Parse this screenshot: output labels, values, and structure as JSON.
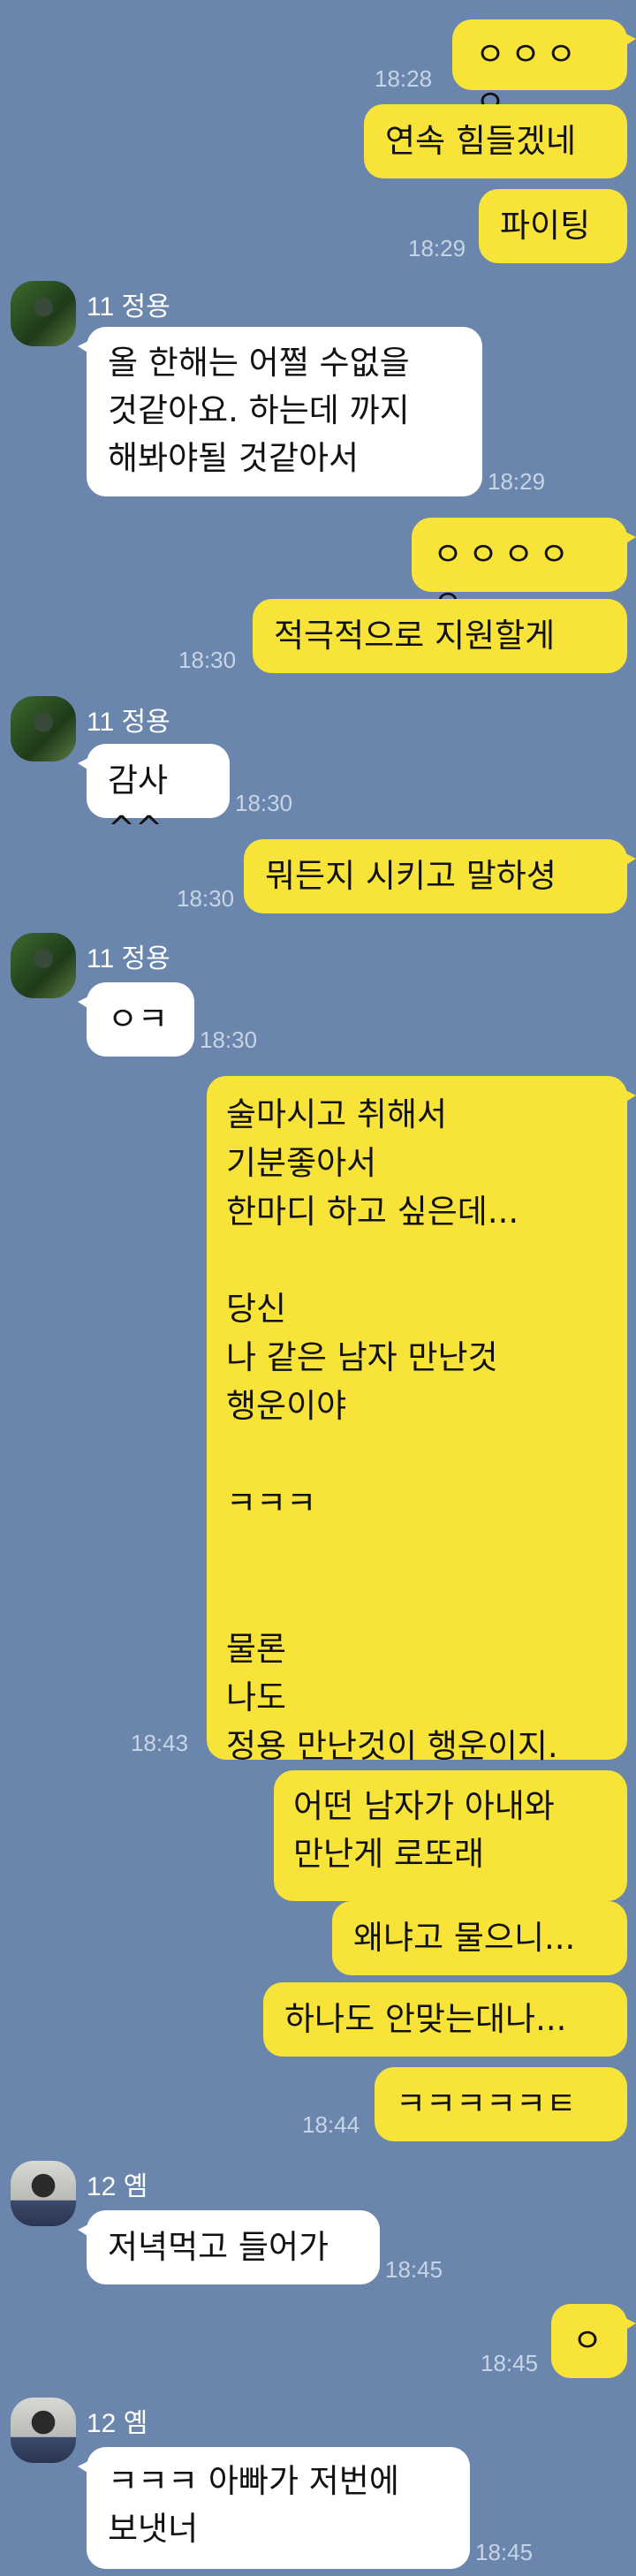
{
  "contacts": {
    "jungyong": {
      "name": "11 정용",
      "avatar_icon": "profile-photo-icon"
    },
    "yem": {
      "name": "12 옘",
      "avatar_icon": "profile-photo-icon"
    }
  },
  "colors": {
    "background": "#6b86ad",
    "my_bubble": "#f8e338",
    "their_bubble": "#ffffff"
  },
  "messages": [
    {
      "text": "ㅇㅇㅇㅇ",
      "time": "18:28"
    },
    {
      "text": "연속 힘들겠네"
    },
    {
      "text": "파이팅",
      "time": "18:29"
    },
    {
      "text": "올 한해는 어쩔 수없을\n것같아요. 하는데 까지\n해봐야될 것같아서",
      "time": "18:29"
    },
    {
      "text": "ㅇㅇㅇㅇㅇ"
    },
    {
      "text": "적극적으로  지원할게",
      "time": "18:30"
    },
    {
      "text": "감사^^",
      "time": "18:30"
    },
    {
      "text": "뭐든지 시키고 말하셩",
      "time": "18:30"
    },
    {
      "text": "ㅇㅋ",
      "time": "18:30"
    },
    {
      "text": "술마시고 취해서\n기분좋아서\n한마디 하고 싶은데...\n\n당신\n나 같은 남자 만난것\n행운이야\n\nㅋㅋㅋ\n\n\n물론\n나도\n정용 만난것이 행운이지.",
      "time": "18:43"
    },
    {
      "text": "어떤 남자가 아내와\n만난게 로또래"
    },
    {
      "text": "왜냐고 물으니..."
    },
    {
      "text": "하나도 안맞는대나..."
    },
    {
      "text": "ㅋㅋㅋㅋㅋㅌ",
      "time": "18:44"
    },
    {
      "text": "저녁먹고 들어가",
      "time": "18:45"
    },
    {
      "text": "ㅇ",
      "time": "18:45"
    },
    {
      "text": "ㅋㅋㅋ 아빠가 저번에\n보냇너",
      "time": "18:45"
    }
  ]
}
